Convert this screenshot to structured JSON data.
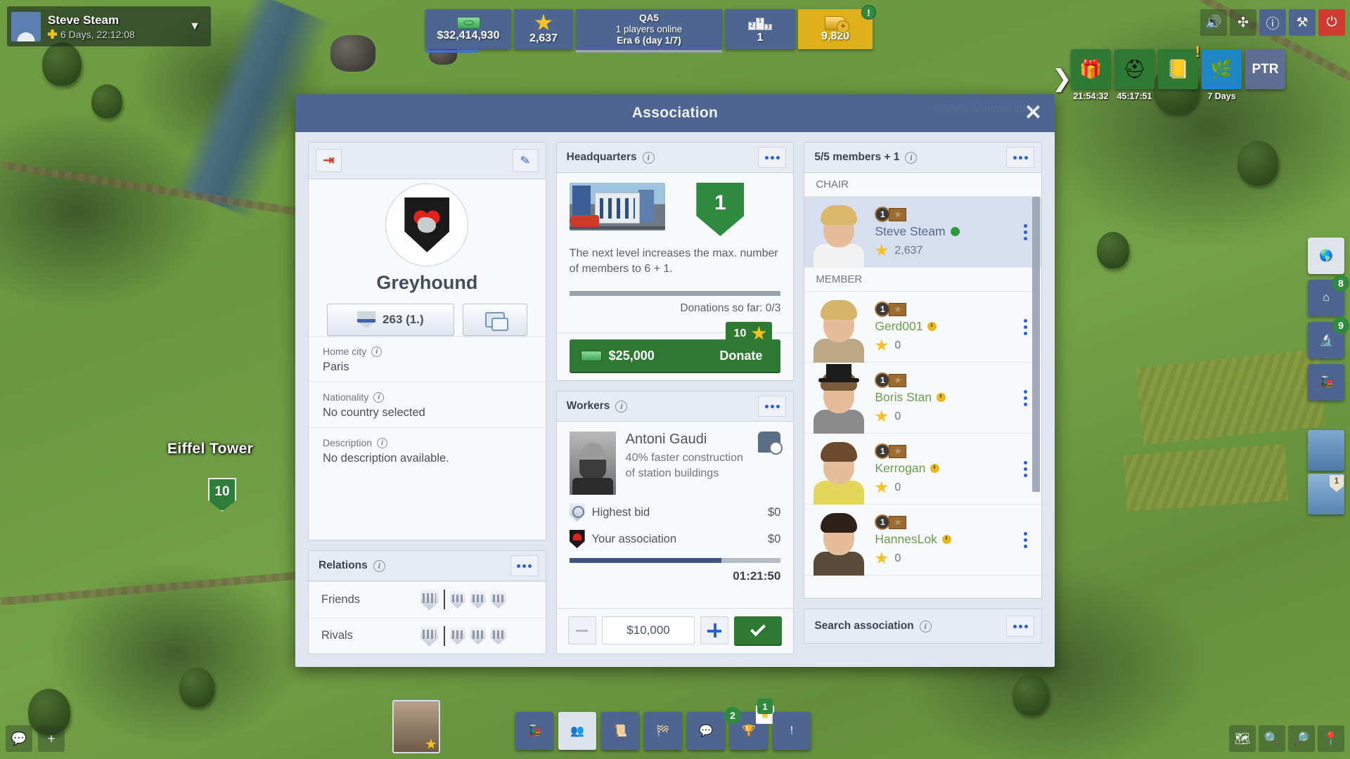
{
  "topbar": {
    "player_name": "Steve Steam",
    "player_time": "6 Days, 22:12:08",
    "chevron": "⌄",
    "resources": {
      "money": "$32,414,930",
      "prestige": "2,637",
      "server_name": "QA5",
      "players_online": "1 players online",
      "era": "Era 6 (day 1/7)",
      "rank": "1",
      "gold": "9,820",
      "gold_alert": "!"
    },
    "system_buttons": [
      {
        "name": "sound-icon",
        "glyph": "🔊"
      },
      {
        "name": "fullscreen-icon",
        "glyph": "✥"
      },
      {
        "name": "help-icon",
        "glyph": "?"
      },
      {
        "name": "tools-icon",
        "glyph": "⚒"
      },
      {
        "name": "power-icon",
        "glyph": "⏻"
      }
    ],
    "events": [
      {
        "name": "gift-event",
        "label": "21:54:32",
        "glyph": "🎁",
        "style": "green",
        "alert": ""
      },
      {
        "name": "helmet-event",
        "label": "45:17:51",
        "glyph": "⛑",
        "style": "green",
        "alert": ""
      },
      {
        "name": "research-event",
        "label": "",
        "glyph": "📒",
        "style": "green",
        "alert": "!"
      },
      {
        "name": "bonus-event",
        "label": "7 Days",
        "glyph": "🌿",
        "style": "blue2",
        "alert": ""
      },
      {
        "name": "ptr-event",
        "label": "",
        "glyph": "PTR",
        "style": "slate",
        "alert": ""
      }
    ]
  },
  "map": {
    "eiffel_label": "Eiffel Tower",
    "eiffel_level": "10"
  },
  "right_tools": [
    {
      "name": "globe-tool",
      "glyph": "🌐",
      "badge": "",
      "light": true
    },
    {
      "name": "buildings-tool",
      "glyph": "⌂",
      "badge": "8",
      "light": false
    },
    {
      "name": "research-tool",
      "glyph": "🔬",
      "badge": "9",
      "light": false
    },
    {
      "name": "train-tool",
      "glyph": "🚂",
      "badge": "",
      "light": false
    }
  ],
  "portraits": [
    {
      "name": "conductor-portrait",
      "badge": ""
    },
    {
      "name": "assistant-portrait",
      "badge": "1"
    }
  ],
  "bottom": {
    "left_buttons": [
      {
        "name": "chat-toggle",
        "glyph": "💬"
      },
      {
        "name": "add-button",
        "glyph": "+"
      }
    ],
    "nav": [
      {
        "name": "trains-nav",
        "glyph": "🚂",
        "active": false,
        "badge": "",
        "badge2": ""
      },
      {
        "name": "association-nav",
        "glyph": "👥",
        "active": true,
        "badge": "",
        "badge2": ""
      },
      {
        "name": "licenses-nav",
        "glyph": "📜",
        "active": false,
        "badge": "",
        "badge2": ""
      },
      {
        "name": "races-nav",
        "glyph": "🏁",
        "active": false,
        "badge": "",
        "badge2": ""
      },
      {
        "name": "messages-nav",
        "glyph": "💬",
        "active": false,
        "badge": "",
        "badge2": ""
      },
      {
        "name": "trophies-nav",
        "glyph": "🏆",
        "active": false,
        "badge": "2",
        "badge2": "1"
      },
      {
        "name": "alerts-nav",
        "glyph": "!",
        "active": false,
        "badge": "",
        "badge2": ""
      }
    ],
    "right_buttons": [
      {
        "name": "map-view-icon",
        "glyph": "🗺"
      },
      {
        "name": "zoom-in-icon",
        "glyph": "⊕"
      },
      {
        "name": "zoom-out-icon",
        "glyph": "⊖"
      },
      {
        "name": "location-pin-icon",
        "glyph": "📍"
      }
    ]
  },
  "modal": {
    "title": "Association",
    "close_label": "✕",
    "watermark": "Cattura schermo intero"
  },
  "profile": {
    "leave_icon": "⮕",
    "edit_icon": "✎",
    "name": "Greyhound",
    "rank_value": "263 (1.)",
    "fields": [
      {
        "label": "Home city",
        "value": "Paris"
      },
      {
        "label": "Nationality",
        "value": "No country selected"
      },
      {
        "label": "Description",
        "value": "No description available."
      }
    ]
  },
  "relations": {
    "title": "Relations",
    "rows": [
      {
        "label": "Friends"
      },
      {
        "label": "Rivals"
      }
    ]
  },
  "headquarters": {
    "title": "Headquarters",
    "level": "1",
    "description": "The next level increases the max. number of members to 6 + 1.",
    "donations": "Donations so far: 0/3",
    "donate_amount": "$25,000",
    "donate_label": "Donate",
    "reward_count": "10"
  },
  "workers": {
    "title": "Workers",
    "worker_name": "Antoni Gaudi",
    "worker_bonus": "40% faster construction of station buildings",
    "rows": [
      {
        "label": "Highest bid",
        "value": "$0",
        "icon": "no-bid-shield"
      },
      {
        "label": "Your association",
        "value": "$0",
        "icon": "association-crest"
      }
    ],
    "timer": "01:21:50",
    "progress_pct": 72,
    "bid_value": "$10,000",
    "minus_label": "−",
    "plus_label": "+",
    "confirm_label": "✓"
  },
  "members": {
    "title": "5/5 members + 1",
    "groups": [
      {
        "label": "CHAIR",
        "rows": [
          {
            "rank": "1",
            "name": "Steve Steam",
            "status": "online",
            "score": "2,637",
            "role": "chair",
            "hair": "#d9b86a",
            "body": "#f2f2f2"
          }
        ]
      },
      {
        "label": "MEMBER",
        "rows": [
          {
            "rank": "1",
            "name": "Gerd001",
            "status": "away",
            "score": "0",
            "role": "member",
            "hair": "#d6b46a",
            "body": "#bca887"
          },
          {
            "rank": "1",
            "name": "Boris Stan",
            "status": "away",
            "score": "0",
            "role": "member",
            "hair": "#7a5a3a",
            "body": "#8a8a8a",
            "hat": true
          },
          {
            "rank": "1",
            "name": "Kerrogan",
            "status": "away",
            "score": "0",
            "role": "member",
            "hair": "#6b4a2e",
            "body": "#e3d65a"
          },
          {
            "rank": "1",
            "name": "HannesLok",
            "status": "away",
            "score": "0",
            "role": "member",
            "hair": "#2e2218",
            "body": "#5a4a3a"
          }
        ]
      }
    ]
  },
  "search": {
    "title": "Search association"
  }
}
